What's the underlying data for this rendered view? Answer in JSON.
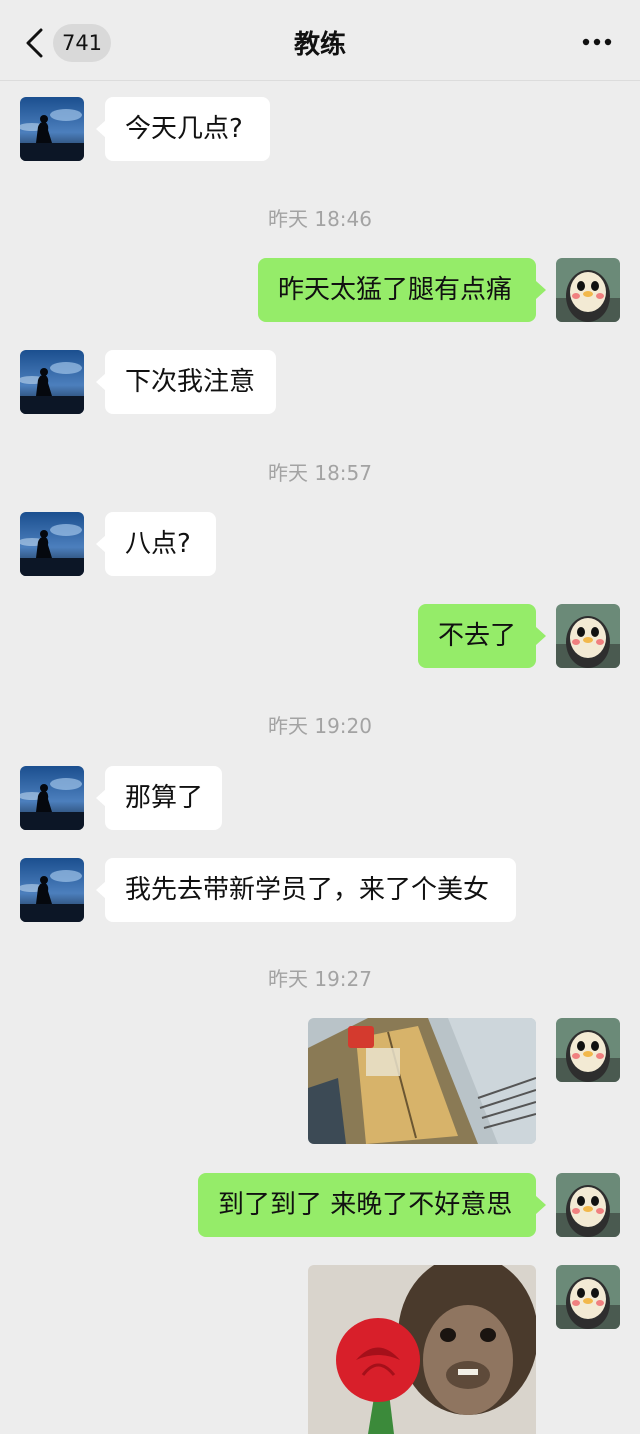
{
  "nav": {
    "badge": "741",
    "title": "教练"
  },
  "messages": [
    {
      "text": "今天几点?"
    },
    {
      "time": "昨天 18:46"
    },
    {
      "text": "昨天太猛了腿有点痛"
    },
    {
      "text": "下次我注意"
    },
    {
      "time": "昨天 18:57"
    },
    {
      "text": "八点?"
    },
    {
      "text": "不去了"
    },
    {
      "time": "昨天 19:20"
    },
    {
      "text": "那算了"
    },
    {
      "text": "我先去带新学员了，来了个美女"
    },
    {
      "time": "昨天 19:27"
    },
    {
      "image": "elevator-photo"
    },
    {
      "text": "到了到了 来晚了不好意思"
    },
    {
      "image": "monkey-rose-sticker"
    }
  ],
  "colors": {
    "outgoing_bubble": "#95ec69",
    "incoming_bubble": "#ffffff",
    "background": "#ededed"
  },
  "icons": [
    "back-icon",
    "more-icon"
  ]
}
